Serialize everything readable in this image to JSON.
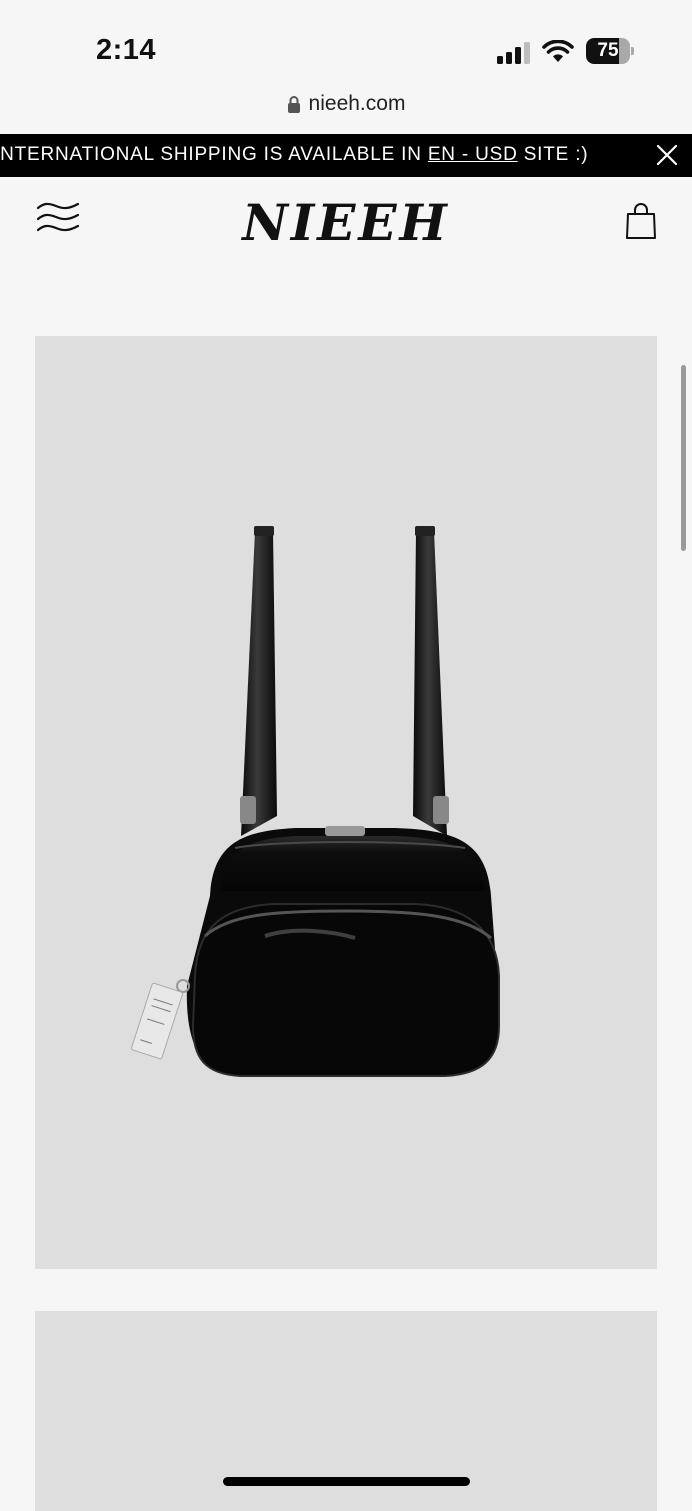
{
  "status_bar": {
    "time": "2:14",
    "battery_level": "75",
    "battery_fraction": 0.75
  },
  "browser": {
    "url": "nieeh.com"
  },
  "announcement": {
    "text_before": "INTERNATIONAL SHIPPING IS AVAILABLE IN ",
    "link": "EN - USD",
    "text_after": " SITE :)"
  },
  "header": {
    "logo": "NIEEH"
  },
  "icons": {
    "menu": "menu-icon",
    "bag": "shopping-bag-icon",
    "close": "close-icon",
    "lock": "lock-icon"
  },
  "colors": {
    "announcement_bg": "#000000",
    "product_bg": "#dedede",
    "page_bg": "#f6f6f6"
  }
}
